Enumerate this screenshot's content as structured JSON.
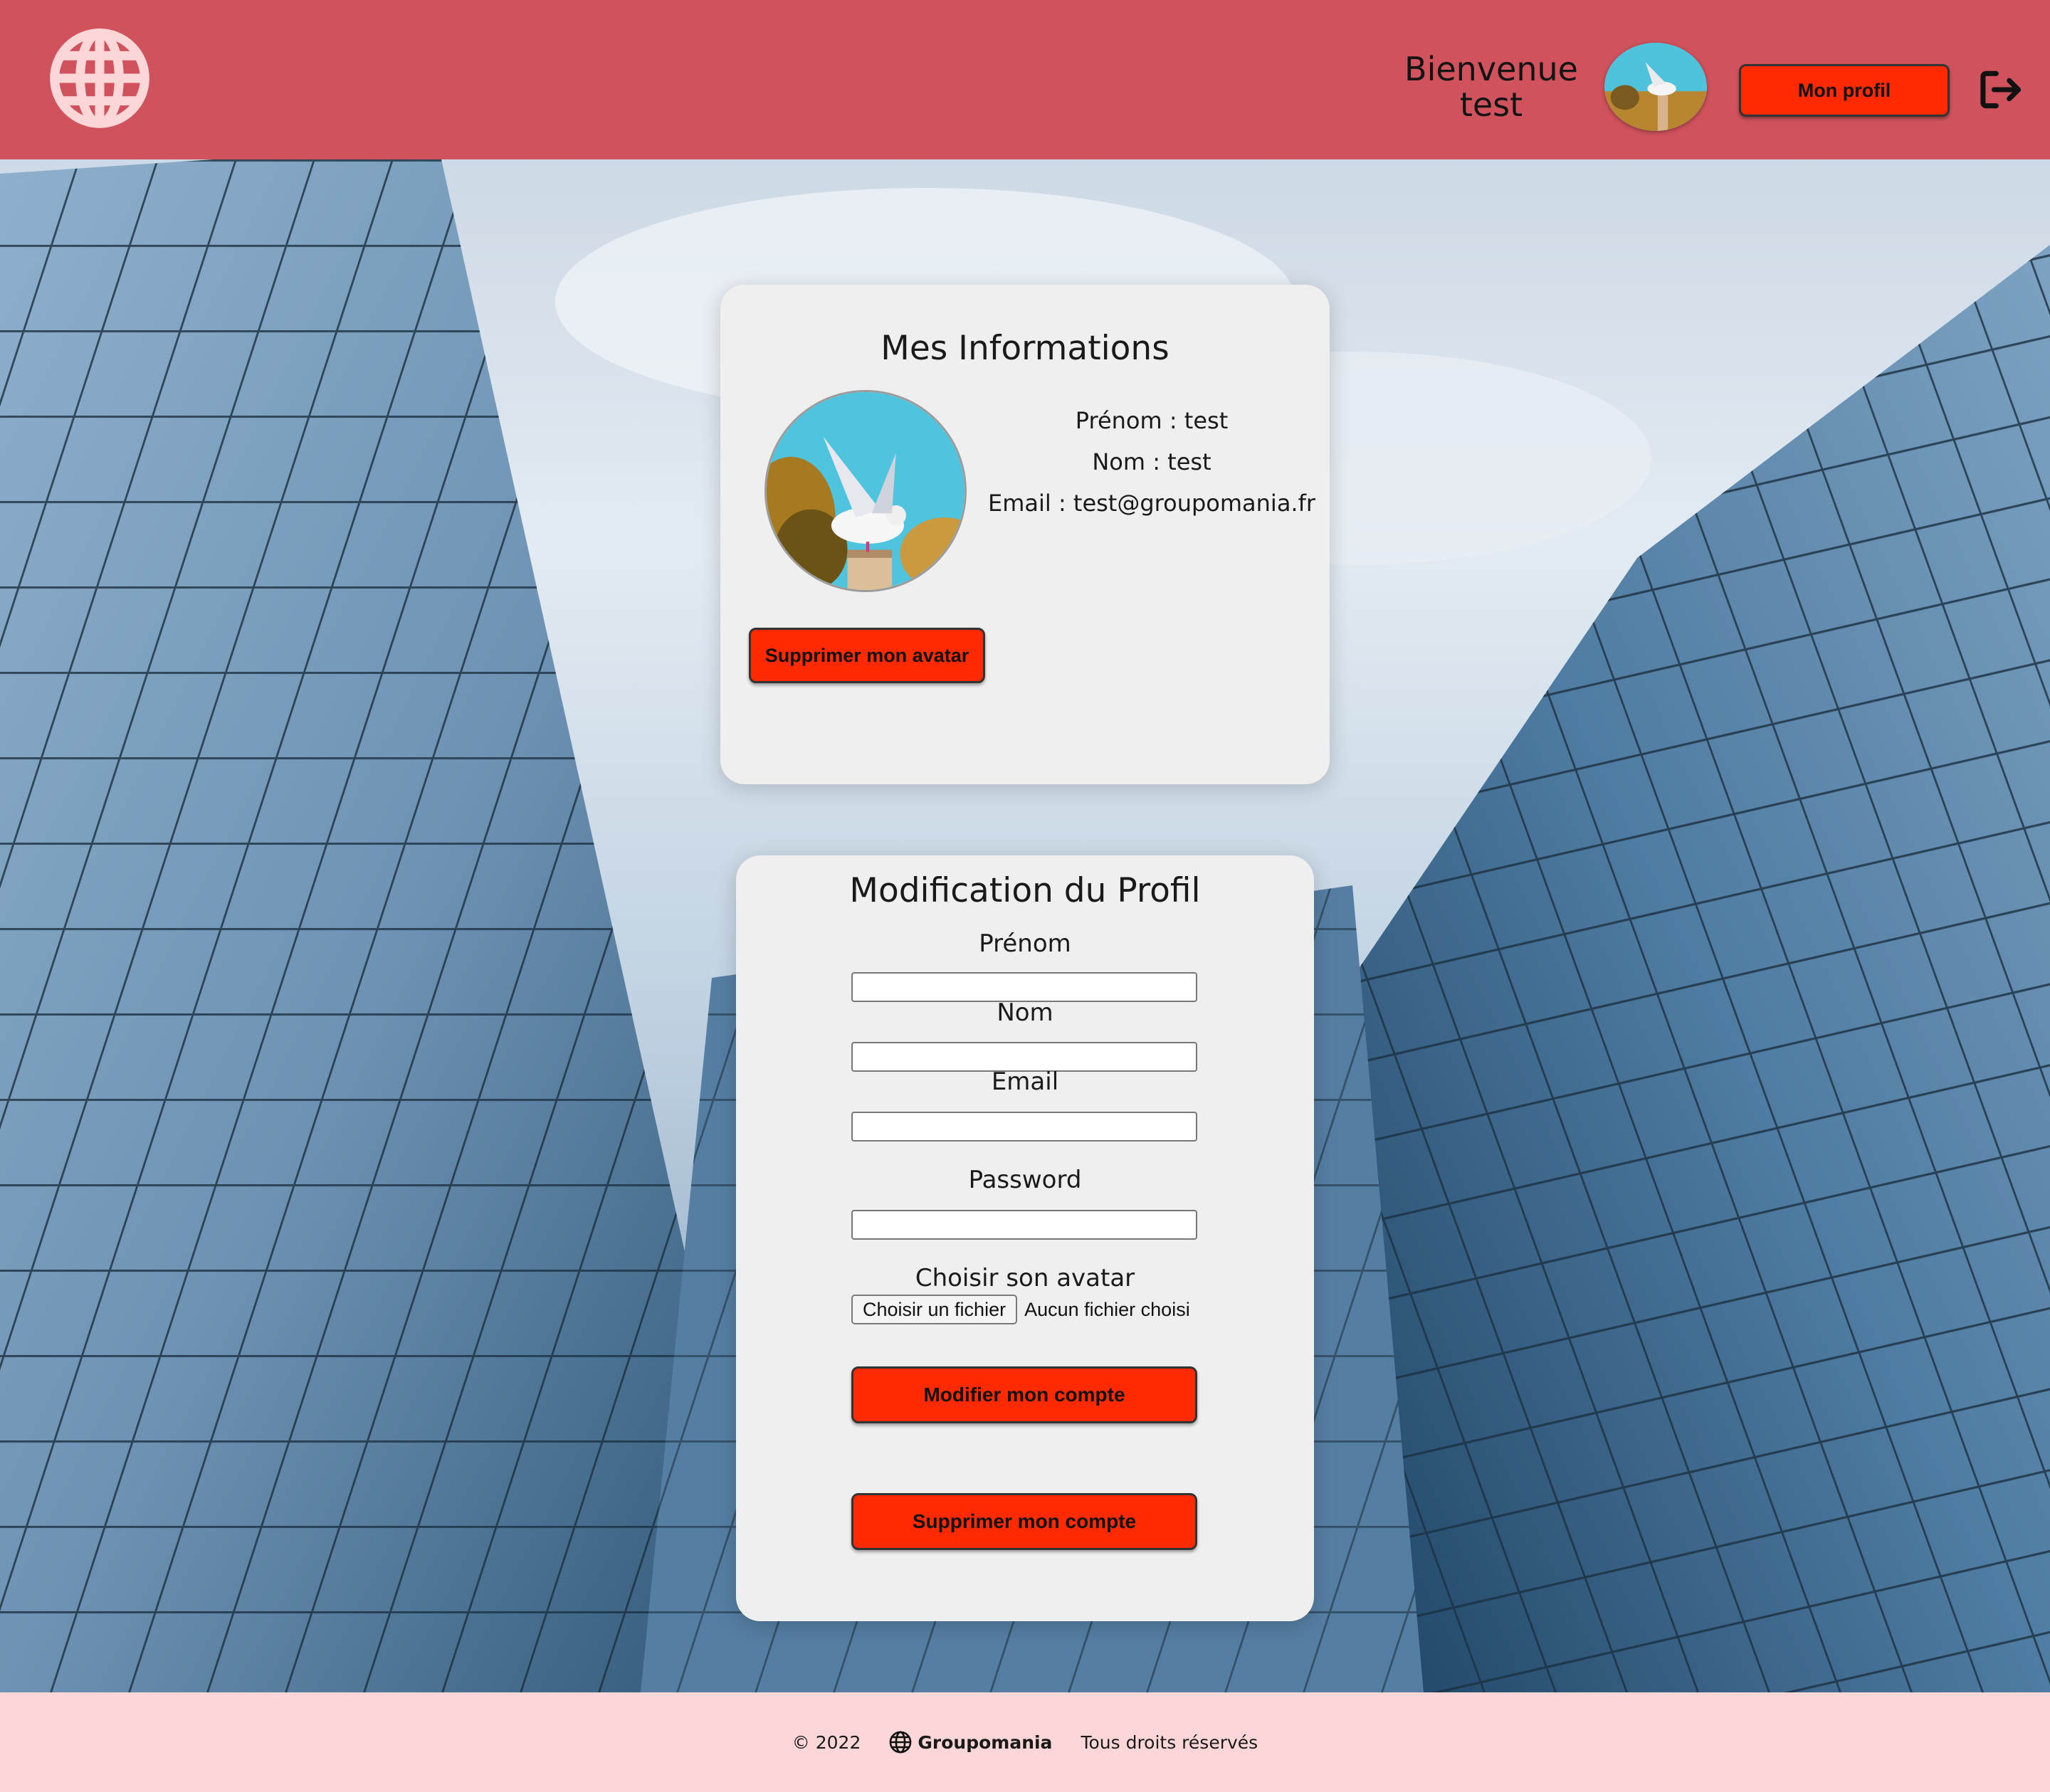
{
  "header": {
    "welcome_line1": "Bienvenue",
    "welcome_line2": "test",
    "profile_button": "Mon profil",
    "logo_icon": "globe-icon",
    "logout_icon": "logout-icon"
  },
  "info": {
    "title": "Mes Informations",
    "firstname": "Prénom : test",
    "lastname": "Nom : test",
    "email": "Email : test@groupomania.fr",
    "delete_avatar_button": "Supprimer mon avatar"
  },
  "edit": {
    "title": "Modification du Profil",
    "firstname_label": "Prénom",
    "lastname_label": "Nom",
    "email_label": "Email",
    "password_label": "Password",
    "avatar_label": "Choisir son avatar",
    "file_button": "Choisir un fichier",
    "file_status": "Aucun fichier choisi",
    "modify_button": "Modifier mon compte",
    "delete_button": "Supprimer mon compte"
  },
  "footer": {
    "copyright": "© 2022",
    "brand": "Groupomania",
    "rights": "Tous droits réservés"
  },
  "colors": {
    "header_bg": "#cf525c",
    "footer_bg": "#fdd7d7",
    "button_bg": "#ff2a00",
    "card_bg": "#efefef"
  }
}
